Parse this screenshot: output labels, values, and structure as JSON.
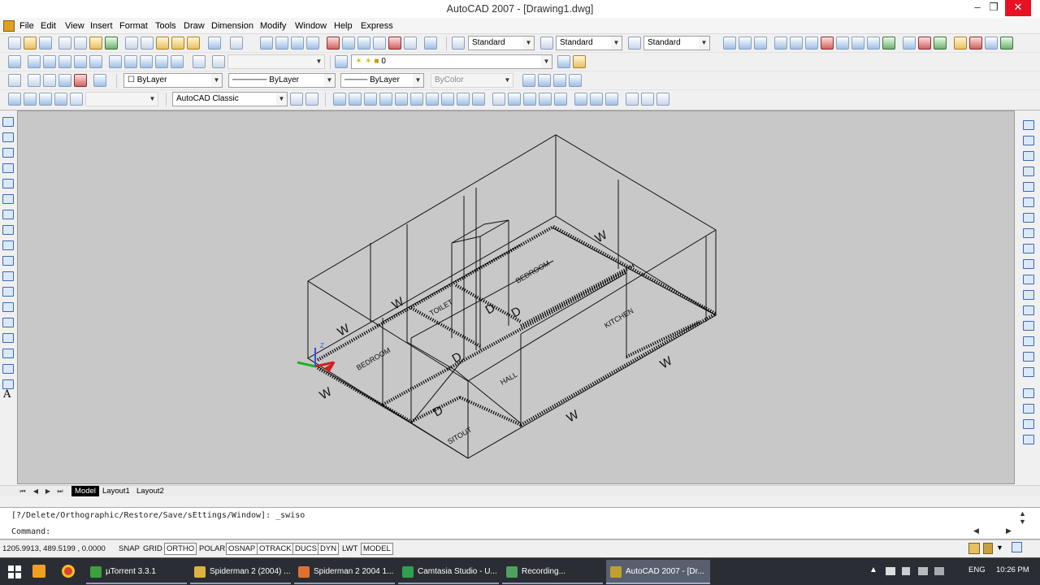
{
  "window": {
    "title": "AutoCAD 2007 - [Drawing1.dwg]",
    "min_glyph": "–",
    "max_glyph": "❐",
    "close_glyph": "✕"
  },
  "menu": [
    "File",
    "Edit",
    "View",
    "Insert",
    "Format",
    "Tools",
    "Draw",
    "Dimension",
    "Modify",
    "Window",
    "Help",
    "Express"
  ],
  "toolbars": {
    "text_style": "Standard",
    "dim_style": "Standard",
    "table_style": "Standard",
    "layer": "0",
    "color": "ByLayer",
    "linetype": "ByLayer",
    "lineweight": "ByLayer",
    "plot_style": "ByColor",
    "workspace": "AutoCAD Classic"
  },
  "drawing": {
    "rooms": [
      "BEDROOM",
      "TOILET",
      "BEDROOM",
      "KITCHEN",
      "HALL",
      "SITOUT"
    ],
    "window_marks": [
      "W",
      "W",
      "W",
      "W",
      "W",
      "W"
    ],
    "door_marks": [
      "D",
      "D",
      "D",
      "D"
    ],
    "ucs": {
      "z": "Z"
    }
  },
  "layout_tabs": [
    "Model",
    "Layout1",
    "Layout2"
  ],
  "command": {
    "history": "[?/Delete/Orthographic/Restore/Save/sEttings/Window]: _swiso",
    "prompt": "Command:"
  },
  "status": {
    "coordinates": "1205.9913, 489.5199 , 0.0000",
    "toggles": [
      {
        "label": "SNAP",
        "on": false
      },
      {
        "label": "GRID",
        "on": false
      },
      {
        "label": "ORTHO",
        "on": true
      },
      {
        "label": "POLAR",
        "on": false
      },
      {
        "label": "OSNAP",
        "on": true
      },
      {
        "label": "OTRACK",
        "on": true
      },
      {
        "label": "DUCS",
        "on": true
      },
      {
        "label": "DYN",
        "on": true
      },
      {
        "label": "LWT",
        "on": false
      },
      {
        "label": "MODEL",
        "on": true
      }
    ]
  },
  "taskbar": {
    "items": [
      {
        "label": "µTorrent 3.3.1",
        "color": "#3aa040"
      },
      {
        "label": "Spiderman 2 (2004) ...",
        "color": "#e0b040"
      },
      {
        "label": "Spiderman 2 2004 1...",
        "color": "#e07030"
      },
      {
        "label": "Camtasia Studio - U...",
        "color": "#30a050"
      },
      {
        "label": "Recording...",
        "color": "#50a060"
      },
      {
        "label": "AutoCAD 2007 - [Dr...",
        "color": "#c0a030"
      }
    ],
    "lang": "ENG",
    "time": "10:26 PM"
  }
}
